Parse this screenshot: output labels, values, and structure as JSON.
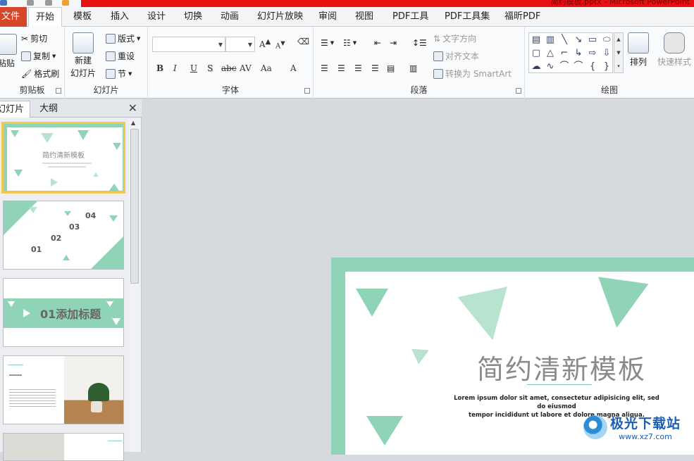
{
  "titlebar": {
    "title": "简约模板.pptx - Microsoft PowerPoint"
  },
  "menu": {
    "file": "文件",
    "tabs": [
      "开始",
      "模板",
      "插入",
      "设计",
      "切换",
      "动画",
      "幻灯片放映",
      "审阅",
      "视图",
      "PDF工具",
      "PDF工具集",
      "福昕PDF"
    ]
  },
  "ribbon": {
    "clipboard": {
      "paste": "粘贴",
      "cut": "剪切",
      "copy": "复制",
      "format_painter": "格式刷",
      "label": "剪贴板"
    },
    "slides": {
      "new_slide_l1": "新建",
      "new_slide_l2": "幻灯片",
      "layout": "版式",
      "reset": "重设",
      "section": "节",
      "label": "幻灯片"
    },
    "font": {
      "label": "字体",
      "bold": "B",
      "italic": "I",
      "underline": "U",
      "shadow": "S",
      "strike": "abc",
      "spacing": "AV",
      "case": "Aa",
      "color": "A"
    },
    "paragraph": {
      "label": "段落",
      "text_direction": "文字方向",
      "align_text": "对齐文本",
      "smartart": "转换为 SmartArt"
    },
    "drawing": {
      "label": "绘图",
      "arrange": "排列",
      "quick_styles": "快速样式"
    }
  },
  "pane": {
    "tab_slides": "幻灯片",
    "tab_outline": "大纲"
  },
  "thumbs": {
    "t1": {
      "title": "简约清新模板"
    },
    "t2": {
      "n1": "01",
      "n2": "02",
      "n3": "03",
      "n4": "04"
    },
    "t3": {
      "title": "01添加标题"
    }
  },
  "slide": {
    "title": "简约清新模板",
    "lorem_l1": "Lorem ipsum dolor sit amet, consectetur adipisicing elit, sed do eiusmod",
    "lorem_l2": "tempor incididunt ut labore et dolore magna aliqua."
  },
  "watermark": {
    "name": "极光下载站",
    "url": "www.xz7.com"
  },
  "colors": {
    "accent": "#90d4b8",
    "file_tab": "#d7462a",
    "titlebar_red": "#e81010"
  }
}
